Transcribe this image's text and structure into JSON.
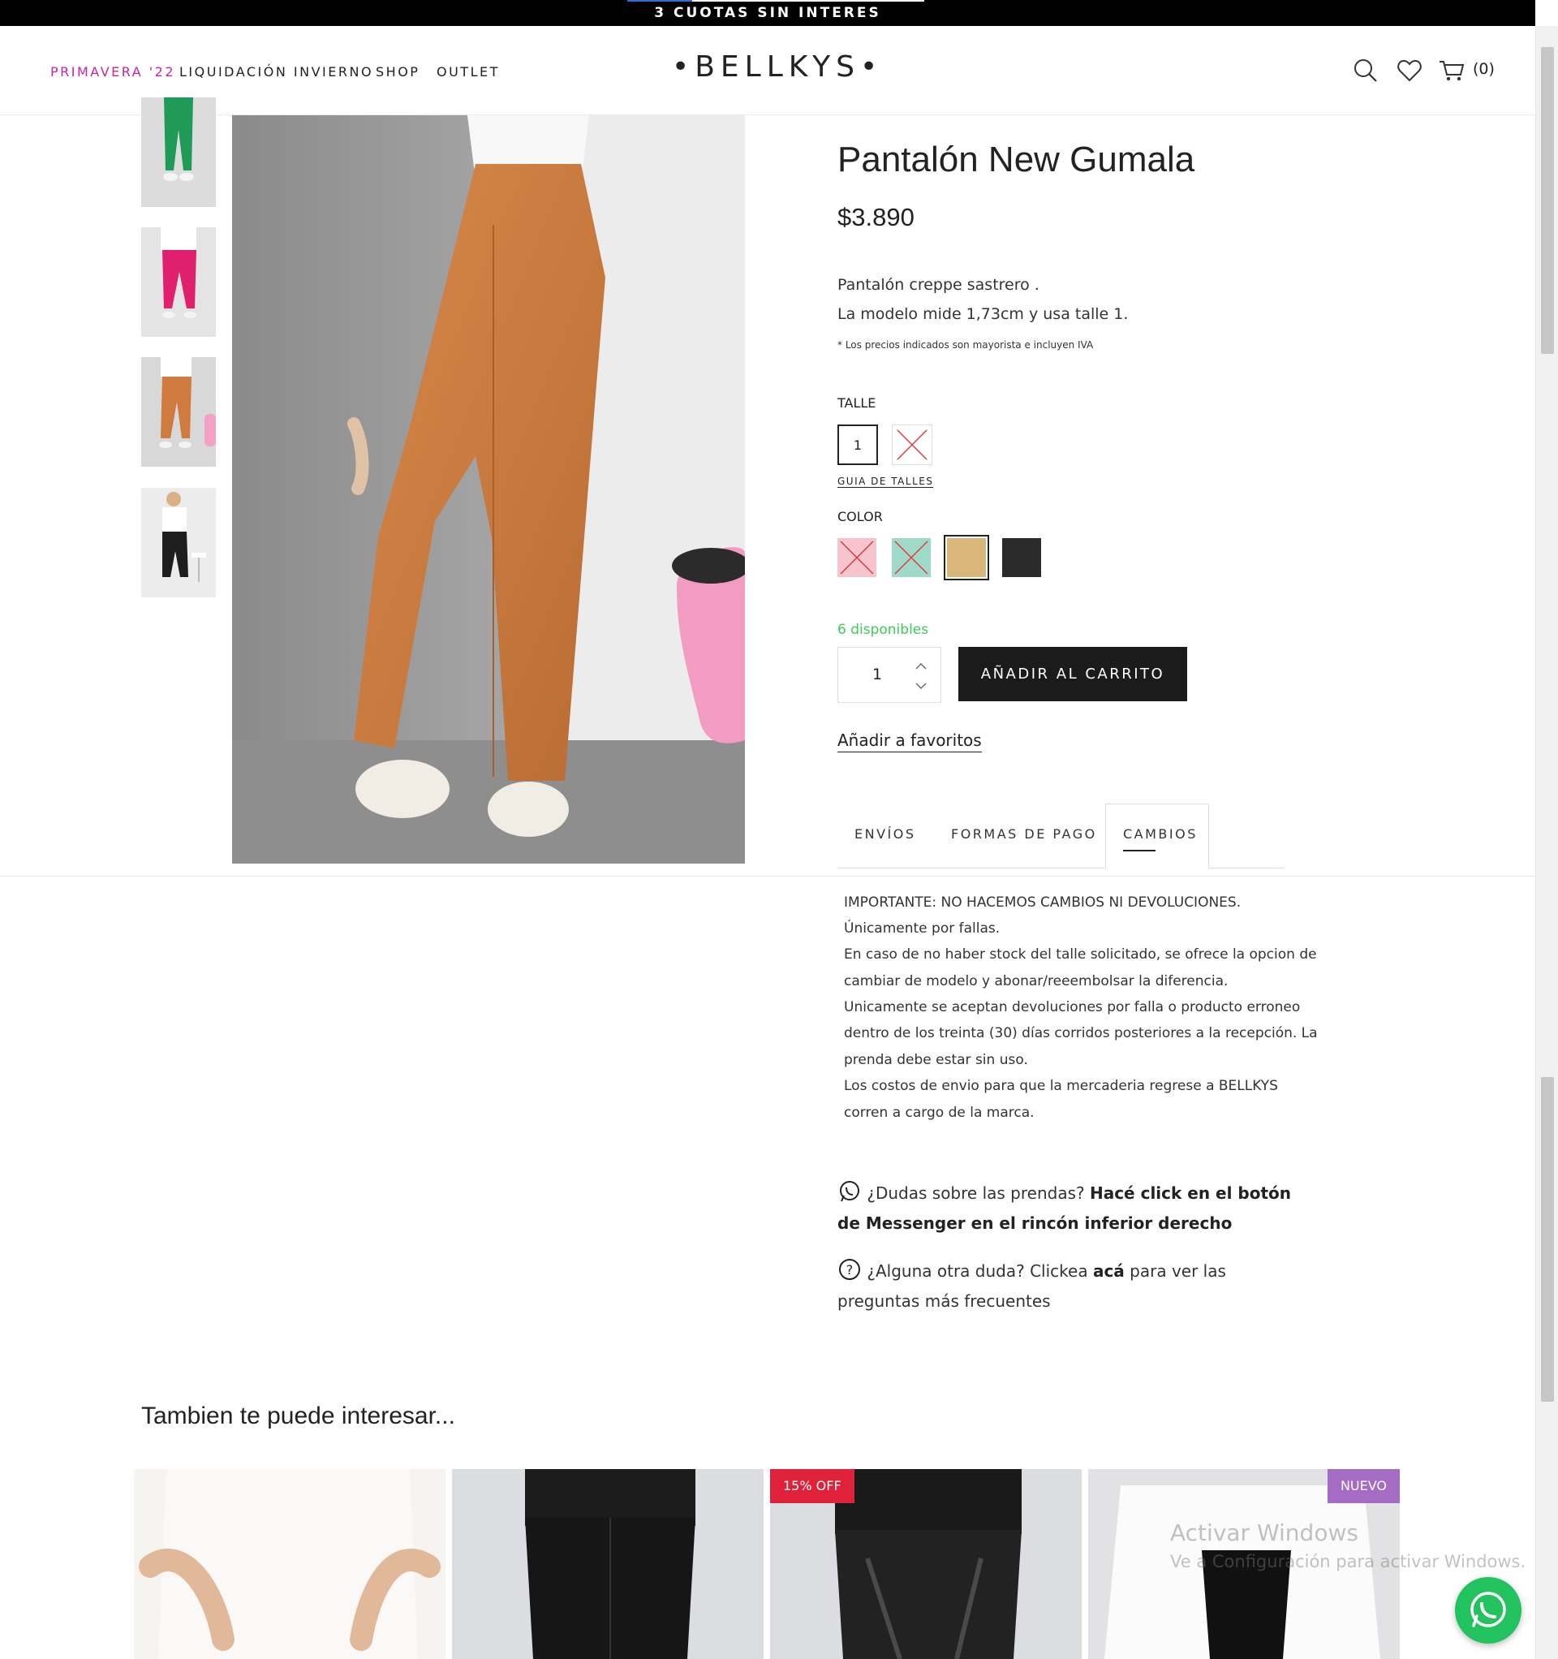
{
  "promo": {
    "text": "3 CUOTAS SIN INTERES"
  },
  "nav": {
    "items": [
      {
        "label": "PRIMAVERA '22",
        "color": "#c624a8"
      },
      {
        "label": "LIQUIDACIÓN INVIERNO",
        "color": "#222222"
      },
      {
        "label": "SHOP",
        "color": "#222222"
      },
      {
        "label": "OUTLET",
        "color": "#222222"
      }
    ],
    "logo": "•BELLKYS•",
    "cart_count": "(0)"
  },
  "product": {
    "title": "Pantalón New Gumala",
    "price": "$3.890",
    "description_lines": [
      "Pantalón creppe sastrero .",
      "La modelo mide 1,73cm y usa talle 1."
    ],
    "disclaimer": "* Los precios indicados son mayorista e incluyen IVA",
    "size_label": "TALLE",
    "sizes": [
      {
        "value": "1",
        "available": true,
        "selected": true
      },
      {
        "value": "",
        "available": false,
        "selected": false
      }
    ],
    "size_guide": "GUIA DE TALLES",
    "color_label": "COLOR",
    "colors": [
      {
        "hex": "#f6c4cf",
        "available": false,
        "selected": false
      },
      {
        "hex": "#9fd9c8",
        "available": false,
        "selected": false
      },
      {
        "hex": "#d9b679",
        "available": true,
        "selected": true
      },
      {
        "hex": "#2b2b2b",
        "available": true,
        "selected": false
      }
    ],
    "stock": "6 disponibles",
    "quantity": "1",
    "add_to_cart": "AÑADIR AL CARRITO",
    "add_to_favorites": "Añadir a favoritos"
  },
  "tabs": [
    {
      "label": "ENVÍOS",
      "active": false
    },
    {
      "label": "FORMAS DE PAGO",
      "active": false
    },
    {
      "label": "CAMBIOS",
      "active": true
    }
  ],
  "policy_lines": [
    "IMPORTANTE: NO HACEMOS CAMBIOS NI DEVOLUCIONES.",
    "Únicamente por fallas.",
    "En caso de no haber stock del talle solicitado, se ofrece la opcion de",
    "cambiar de modelo y abonar/reeembolsar la diferencia.",
    "Unicamente se aceptan devoluciones por falla o producto erroneo",
    "dentro de los treinta (30) días corridos posteriores a la recepción. La",
    "prenda debe estar sin uso.",
    "Los costos de envio para que la mercaderia regrese a BELLKYS",
    "corren a cargo de la marca."
  ],
  "help": {
    "whatsapp_text": "¿Dudas sobre las prendas? ",
    "whatsapp_bold": "Hacé click en el botón de Messenger en el rincón inferior derecho",
    "faq_text_1": "¿Alguna otra duda? Clickea ",
    "faq_bold": "acá",
    "faq_text_2": " para ver las preguntas más frecuentes"
  },
  "recommendations": {
    "title": "Tambien te puede interesar...",
    "cards": [
      {
        "badge": "",
        "badge_color": ""
      },
      {
        "badge": "",
        "badge_color": ""
      },
      {
        "badge": "15% OFF",
        "badge_color": "#e0213a"
      },
      {
        "badge": "NUEVO",
        "badge_color": "#a56cc6"
      }
    ]
  },
  "watermark": {
    "line1": "Activar Windows",
    "line2": "Ve a Configuración para activar Windows."
  }
}
